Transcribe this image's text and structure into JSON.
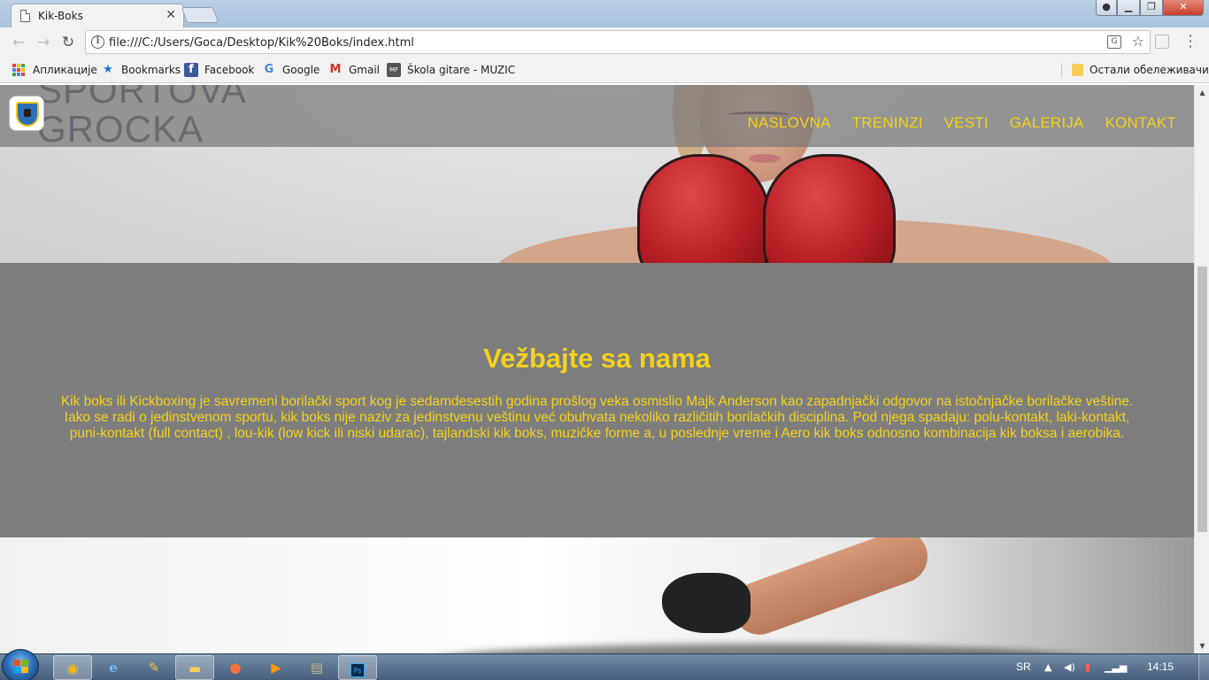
{
  "browser": {
    "tab_title": "Kik-Boks",
    "address": "file:///C:/Users/Goca/Desktop/Kik%20Boks/index.html",
    "bookmarks": [
      {
        "label": "Апликације",
        "icon": "apps-grid-icon"
      },
      {
        "label": "Bookmarks",
        "icon": "star-icon"
      },
      {
        "label": "Facebook",
        "icon": "facebook-icon"
      },
      {
        "label": "Google",
        "icon": "google-icon"
      },
      {
        "label": "Gmail",
        "icon": "gmail-icon"
      },
      {
        "label": "Škola gitare - MUZIC",
        "icon": "mf-icon"
      }
    ],
    "other_bookmarks": "Остали обележивачи"
  },
  "site": {
    "brand_line1": "SPORTOVA",
    "brand_line2": "GROCKA",
    "nav": [
      "NASLOVNA",
      "TRENINZI",
      "VESTI",
      "GALERIJA",
      "KONTAKT"
    ],
    "heading": "Vežbajte sa nama",
    "body": "Kik boks ili Kickboxing je savremeni borilački sport kog je sedamdesestih godina prošlog veka osmislio Majk Anderson kao zapadnjački odgovor na istočnjačke borilačke veštine. Iako se radi o jedinstvenom sportu, kik boks nije naziv za jedinstvenu veštinu već obuhvata nekoliko različitih borilačkih disciplina. Pod njega spadaju: polu-kontakt, laki-kontakt, puni-kontakt (full contact) , lou-kik (low kick ili niski udarac), tajlandski kik boks, muzičke forme a, u poslednje vreme i Aero kik boks odnosno kombinacija kik boksa i aerobika."
  },
  "taskbar": {
    "language": "SR",
    "clock": "14:15"
  },
  "colors": {
    "accent_yellow": "#f5d21a",
    "panel_gray": "#7d7d7d",
    "header_overlay": "#787878"
  }
}
